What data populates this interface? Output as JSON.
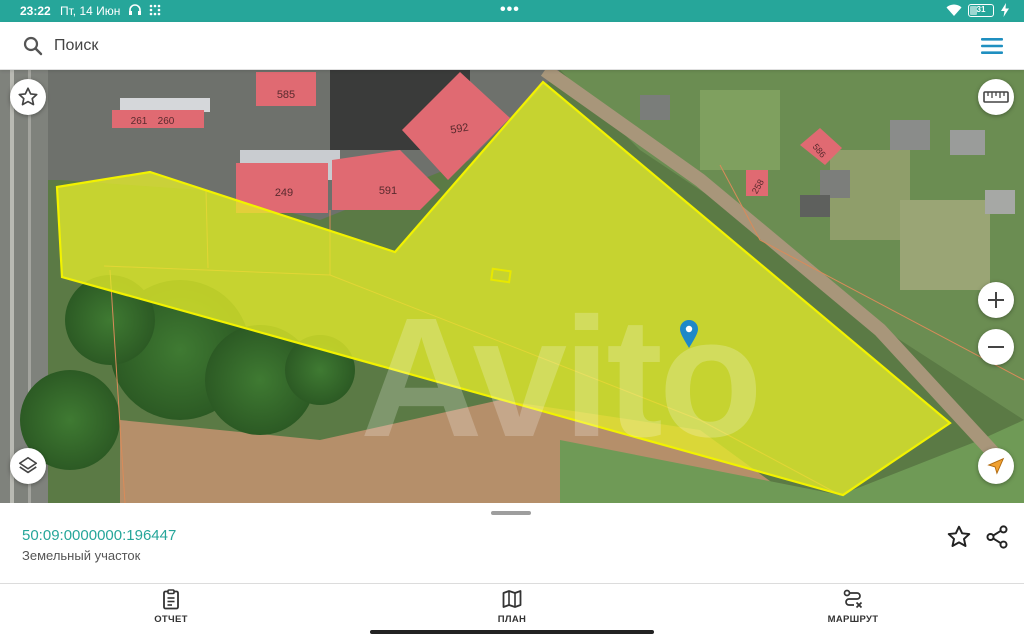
{
  "status_bar": {
    "time": "23:22",
    "date": "Пт, 14 Июн",
    "battery": "31",
    "menu_dots": "•••"
  },
  "search": {
    "placeholder": "Поиск",
    "value": ""
  },
  "map": {
    "parcel_labels": [
      "585",
      "261",
      "260",
      "592",
      "249",
      "591",
      "258",
      "586"
    ],
    "watermark": "Avito"
  },
  "info": {
    "cadastral_number": "50:09:0000000:196447",
    "object_type": "Земельный участок"
  },
  "bottom_nav": {
    "items": [
      {
        "label": "ОТЧЕТ",
        "icon": "clipboard-icon"
      },
      {
        "label": "ПЛАН",
        "icon": "map-icon"
      },
      {
        "label": "МАРШРУТ",
        "icon": "route-icon"
      }
    ]
  },
  "colors": {
    "accent": "#26a69a",
    "parcel_fill": "#e4ec2a",
    "parcel_outline": "#f2f200",
    "building": "#e06a72",
    "marker": "#1e88c8"
  }
}
